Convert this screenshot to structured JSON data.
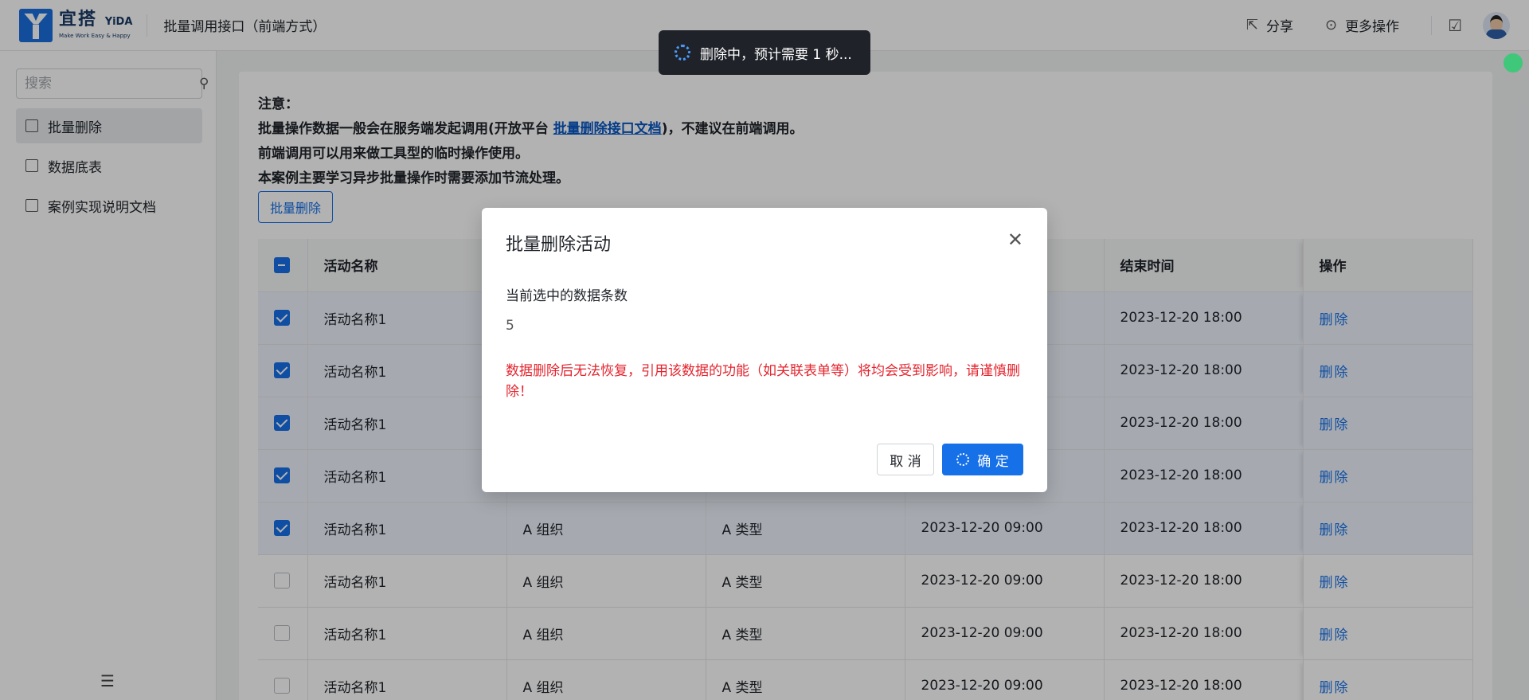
{
  "header": {
    "logo_cn": "宜搭",
    "logo_en": "YiDA",
    "logo_tagline": "Make Work Easy & Happy",
    "page_title": "批量调用接口（前端方式）",
    "share_label": "分享",
    "more_label": "更多操作"
  },
  "sidebar": {
    "search_placeholder": "搜索",
    "items": [
      {
        "label": "批量删除"
      },
      {
        "label": "数据底表"
      },
      {
        "label": "案例实现说明文档"
      }
    ]
  },
  "notice": {
    "line0": "注意：",
    "line1_prefix": "批量操作数据一般会在服务端发起调用(开放平台 ",
    "line1_link": "批量删除接口文档",
    "line1_suffix": ")，不建议在前端调用。",
    "line2": "前端调用可以用来做工具型的临时操作使用。",
    "line3": "本案例主要学习异步批量操作时需要添加节流处理。"
  },
  "batch_button": "批量删除",
  "table": {
    "headers": [
      "活动名称",
      "",
      "",
      "",
      "结束时间",
      "操作"
    ],
    "rows": [
      {
        "name": "活动名称1",
        "org": "",
        "type": "",
        "start": "",
        "end": "2023-12-20 18:00",
        "op": "删除",
        "checked": true
      },
      {
        "name": "活动名称1",
        "org": "",
        "type": "",
        "start": "",
        "end": "2023-12-20 18:00",
        "op": "删除",
        "checked": true
      },
      {
        "name": "活动名称1",
        "org": "",
        "type": "",
        "start": "",
        "end": "2023-12-20 18:00",
        "op": "删除",
        "checked": true
      },
      {
        "name": "活动名称1",
        "org": "",
        "type": "",
        "start": "",
        "end": "2023-12-20 18:00",
        "op": "删除",
        "checked": true
      },
      {
        "name": "活动名称1",
        "org": "A 组织",
        "type": "A 类型",
        "start": "2023-12-20 09:00",
        "end": "2023-12-20 18:00",
        "op": "删除",
        "checked": true
      },
      {
        "name": "活动名称1",
        "org": "A 组织",
        "type": "A 类型",
        "start": "2023-12-20 09:00",
        "end": "2023-12-20 18:00",
        "op": "删除",
        "checked": false
      },
      {
        "name": "活动名称1",
        "org": "A 组织",
        "type": "A 类型",
        "start": "2023-12-20 09:00",
        "end": "2023-12-20 18:00",
        "op": "删除",
        "checked": false
      },
      {
        "name": "活动名称1",
        "org": "A 组织",
        "type": "A 类型",
        "start": "2023-12-20 09:00",
        "end": "2023-12-20 18:00",
        "op": "删除",
        "checked": false
      }
    ]
  },
  "toast": {
    "text": "删除中，预计需要 1 秒..."
  },
  "dialog": {
    "title": "批量删除活动",
    "count_label": "当前选中的数据条数",
    "count_value": "5",
    "warning": "数据删除后无法恢复，引用该数据的功能（如关联表单等）将均会受到影响，请谨慎删除！",
    "cancel_label": "取 消",
    "ok_label": "确 定"
  },
  "colors": {
    "primary": "#1670e8",
    "warning": "#e4242e",
    "toast_bg": "#1f2329"
  }
}
